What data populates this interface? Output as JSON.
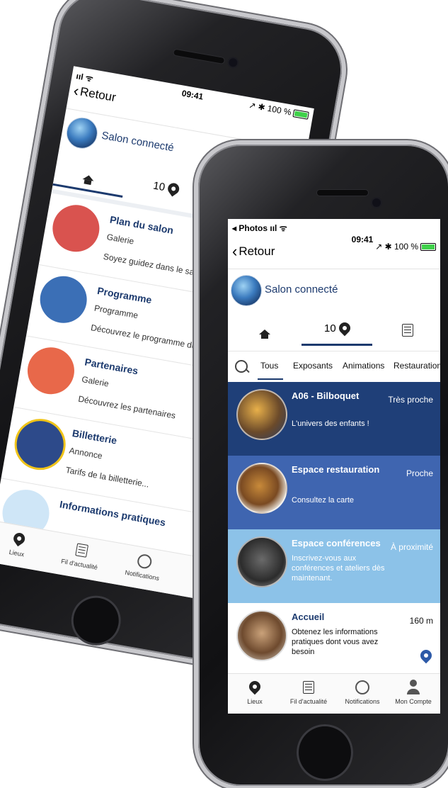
{
  "back_phone": {
    "status": {
      "signal": "ııl ᯤ",
      "time": "09:41",
      "right": "↗ ✱ 100 %"
    },
    "nav": {
      "back_label": "Retour"
    },
    "app": {
      "title": "Salon connecté"
    },
    "tabs": {
      "count": "10"
    },
    "items": [
      {
        "title": "Plan du salon",
        "subtitle": "Galerie",
        "desc": "Soyez guidez dans le salon",
        "color": "#d9534f"
      },
      {
        "title": "Programme",
        "subtitle": "Programme",
        "desc": "Découvrez le programme du s",
        "color": "#3b6fb6"
      },
      {
        "title": "Partenaires",
        "subtitle": "Galerie",
        "desc": "Découvrez les partenaires",
        "color": "#e8684a"
      },
      {
        "title": "Billetterie",
        "subtitle": "Annonce",
        "desc": "Tarifs de la billetterie...",
        "color": "#2d4a8a"
      },
      {
        "title": "Informations pratiques",
        "subtitle": "",
        "desc": "",
        "color": "#7ab8e8"
      }
    ],
    "bottom": {
      "lieux": "Lieux",
      "fil": "Fil d'actualité",
      "notif": "Notifications"
    }
  },
  "front_phone": {
    "status": {
      "left": "◂ Photos ııl ᯤ",
      "time": "09:41",
      "right": "↗ ✱ 100 %"
    },
    "nav": {
      "back_label": "Retour"
    },
    "app": {
      "title": "Salon connecté"
    },
    "tabs": {
      "count": "10"
    },
    "filters": [
      "Tous",
      "Exposants",
      "Animations",
      "Restauration"
    ],
    "cards": [
      {
        "title": "A06 - Bilboquet",
        "distance": "Très proche",
        "desc": "L'univers des enfants !",
        "bg": "#1f3f78"
      },
      {
        "title": "Espace restauration",
        "distance": "Proche",
        "desc": "Consultez la carte",
        "bg": "#3f65b0"
      },
      {
        "title": "Espace conférences",
        "distance": "À proximité",
        "desc": "Inscrivez-vous aux conférences et ateliers dès maintenant.",
        "bg": "#8cc2e8"
      },
      {
        "title": "Accueil",
        "distance": "160 m",
        "desc": "Obtenez les informations pratiques dont vous avez besoin",
        "bg": "#ffffff"
      }
    ],
    "bottom": {
      "lieux": "Lieux",
      "fil": "Fil d'actualité",
      "notif": "Notifications",
      "compte": "Mon Compte"
    }
  }
}
